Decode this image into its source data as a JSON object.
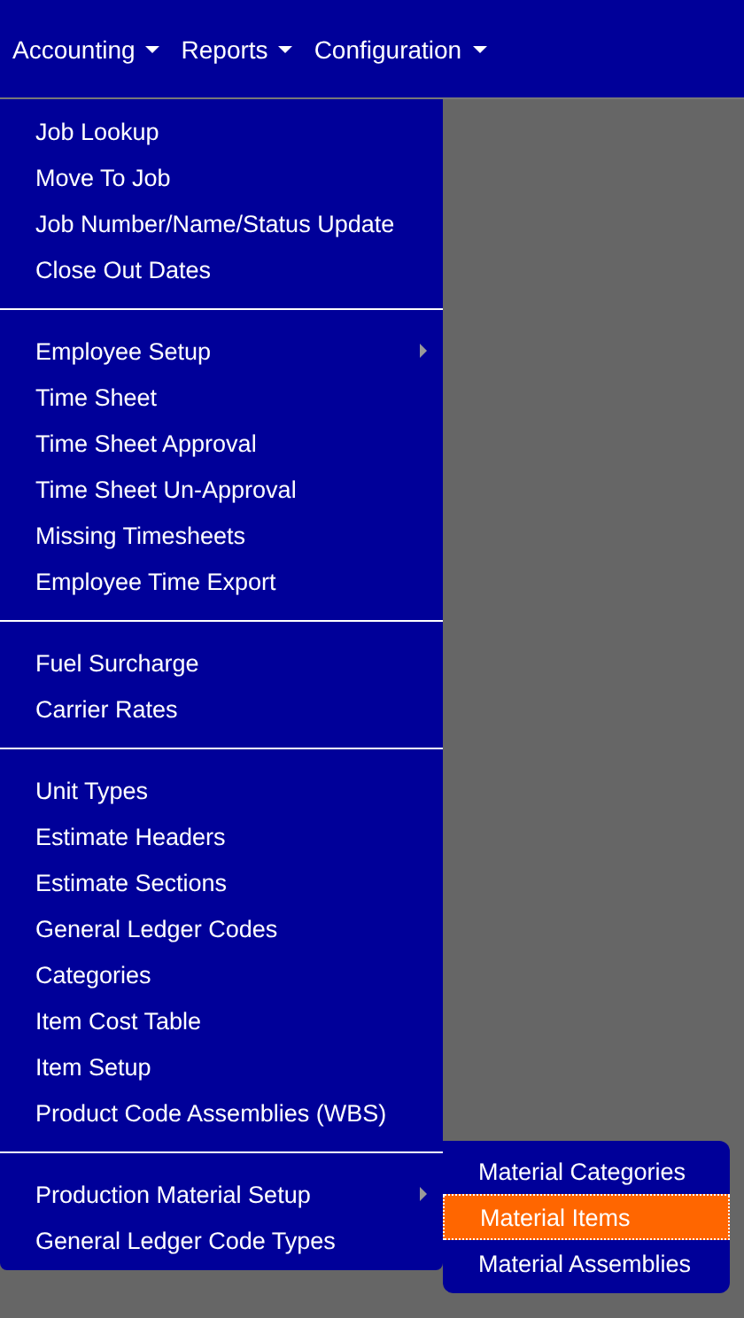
{
  "navbar": {
    "items": [
      {
        "label": "Accounting"
      },
      {
        "label": "Reports"
      },
      {
        "label": "Configuration"
      }
    ]
  },
  "dropdown": {
    "groups": [
      {
        "items": [
          {
            "label": "Job Lookup",
            "has_submenu": false
          },
          {
            "label": "Move To Job",
            "has_submenu": false
          },
          {
            "label": "Job Number/Name/Status Update",
            "has_submenu": false
          },
          {
            "label": "Close Out Dates",
            "has_submenu": false
          }
        ]
      },
      {
        "items": [
          {
            "label": "Employee Setup",
            "has_submenu": true
          },
          {
            "label": "Time Sheet",
            "has_submenu": false
          },
          {
            "label": "Time Sheet Approval",
            "has_submenu": false
          },
          {
            "label": "Time Sheet Un-Approval",
            "has_submenu": false
          },
          {
            "label": "Missing Timesheets",
            "has_submenu": false
          },
          {
            "label": "Employee Time Export",
            "has_submenu": false
          }
        ]
      },
      {
        "items": [
          {
            "label": "Fuel Surcharge",
            "has_submenu": false
          },
          {
            "label": "Carrier Rates",
            "has_submenu": false
          }
        ]
      },
      {
        "items": [
          {
            "label": "Unit Types",
            "has_submenu": false
          },
          {
            "label": "Estimate Headers",
            "has_submenu": false
          },
          {
            "label": "Estimate Sections",
            "has_submenu": false
          },
          {
            "label": "General Ledger Codes",
            "has_submenu": false
          },
          {
            "label": "Categories",
            "has_submenu": false
          },
          {
            "label": "Item Cost Table",
            "has_submenu": false
          },
          {
            "label": "Item Setup",
            "has_submenu": false
          },
          {
            "label": "Product Code Assemblies (WBS)",
            "has_submenu": false
          }
        ]
      },
      {
        "items": [
          {
            "label": "Production Material Setup",
            "has_submenu": true,
            "children": [
              {
                "label": "Material Categories",
                "selected": false
              },
              {
                "label": "Material Items",
                "selected": true
              },
              {
                "label": "Material Assemblies",
                "selected": false
              }
            ]
          },
          {
            "label": "General Ledger Code Types",
            "has_submenu": false
          }
        ]
      }
    ]
  }
}
